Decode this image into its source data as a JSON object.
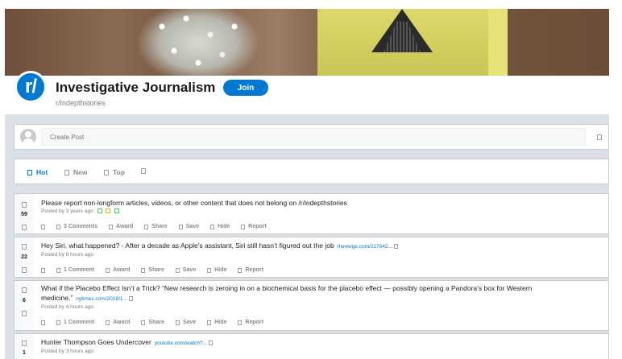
{
  "subreddit": {
    "icon_text": "r/",
    "title": "Investigative Journalism",
    "join_label": "Join",
    "handle": "r/Indepthstories"
  },
  "create_post": {
    "placeholder": "Create Post"
  },
  "sort_tabs": [
    {
      "label": "Hot",
      "active": true
    },
    {
      "label": "New",
      "active": false
    },
    {
      "label": "Top",
      "active": false
    }
  ],
  "posts": [
    {
      "votes": "59",
      "title": "Please report non-longform articles, videos, or other content that does not belong on /r/indepthstories",
      "domain": "",
      "meta": "Posted by 3 years ago",
      "comments": "3 Comments"
    },
    {
      "votes": "22",
      "title": "Hey Siri, what happened? - After a decade as Apple’s assistant, Siri still hasn’t figured out the job",
      "domain": "theverge.com/227042...",
      "meta": "Posted by 6 hours ago",
      "comments": "1 Comment"
    },
    {
      "votes": "6",
      "title": "What if the Placebo Effect Isn’t a Trick? “New research is zeroing in on a biochemical basis for the placebo effect — possibly opening a Pandora’s box for Western medicine.”",
      "domain": "nytimes.com/2018/1...",
      "meta": "Posted by 4 hours ago",
      "comments": "1 Comment"
    },
    {
      "votes": "1",
      "title": "Hunter Thompson Goes Undercover",
      "domain": "youtube.com/watch?...",
      "meta": "Posted by 3 hours ago",
      "comments": ""
    }
  ],
  "actions": {
    "award": "Award",
    "share": "Share",
    "save": "Save",
    "hide": "Hide",
    "report": "Report"
  }
}
